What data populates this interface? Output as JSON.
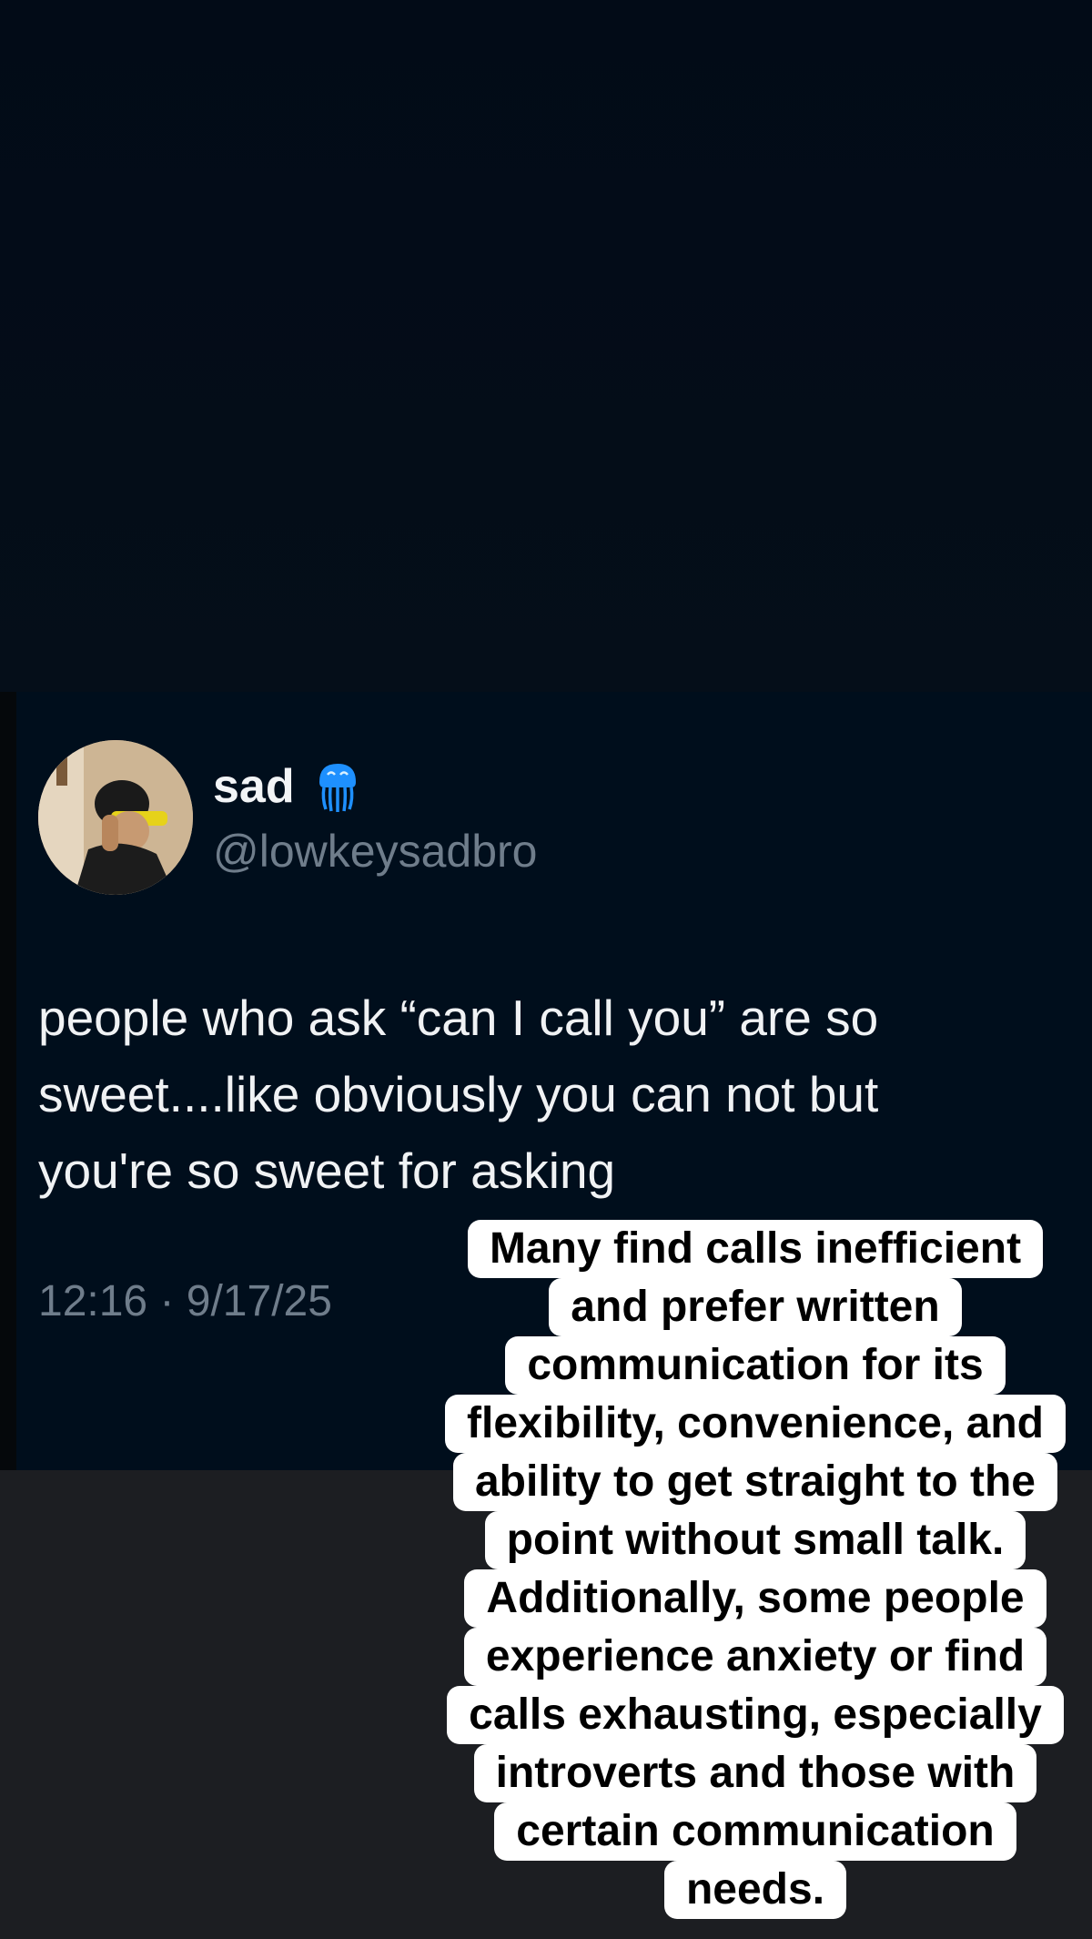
{
  "tweet": {
    "display_name": "sad",
    "badge_icon": "jellyfish-emoji",
    "handle": "@lowkeysadbro",
    "text": "people who ask “can I call you” are so sweet....like obviously you can not but you're so sweet for asking",
    "timestamp": "12:16 · 9/17/25"
  },
  "caption": {
    "lines": [
      "Many find calls inefficient",
      "and prefer written",
      "communication for its",
      "flexibility, convenience, and",
      "ability to get straight to the",
      "point without small talk.",
      "Additionally, some people",
      "experience anxiety or find",
      "calls exhausting, especially",
      "introverts and those with",
      "certain communication",
      "needs."
    ]
  },
  "colors": {
    "background_top": "#020b17",
    "card_background": "#000e1c",
    "bottom_background": "#1c1e22",
    "name_text": "#f2f4f6",
    "muted_text": "#6f7d8b",
    "badge_blue": "#1e90ff"
  }
}
